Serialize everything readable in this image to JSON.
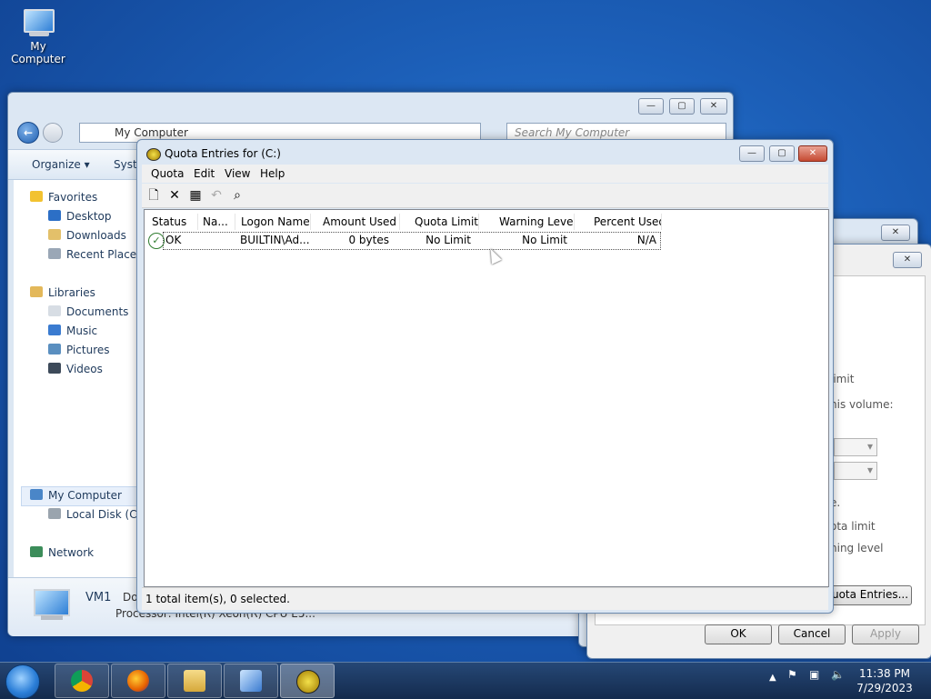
{
  "desktop": {
    "icon_label": "My Computer"
  },
  "explorer": {
    "address": "My Computer",
    "search_placeholder": "Search My Computer",
    "organize_label": "Organize",
    "system_label": "Syste",
    "nav": {
      "favorites": "Favorites",
      "desktop": "Desktop",
      "downloads": "Downloads",
      "recent_places": "Recent Places",
      "libraries": "Libraries",
      "documents": "Documents",
      "music": "Music",
      "pictures": "Pictures",
      "videos": "Videos",
      "my_computer": "My Computer",
      "local_disk": "Local Disk (C:)",
      "network": "Network"
    },
    "details": {
      "name": "VM1",
      "domain_partial": "Do",
      "processor_partial": "Processor: Intel(R) Xeon(R) CPU E5..."
    }
  },
  "quota": {
    "title": "Quota Entries for  (C:)",
    "menu": [
      "Quota",
      "Edit",
      "View",
      "Help"
    ],
    "columns": [
      "Status",
      "Na...",
      "Logon Name",
      "Amount Used",
      "Quota Limit",
      "Warning Level",
      "Percent Used"
    ],
    "rows": [
      {
        "status": "OK",
        "name": "",
        "logon": "BUILTIN\\Ad...",
        "amount": "0 bytes",
        "limit": "No Limit",
        "warning": "No Limit",
        "percent": "N/A"
      }
    ],
    "status_text": "1 total item(s), 0 selected."
  },
  "props_dialog": {
    "frag_limit": "limit",
    "frag_volume": "his volume:",
    "frag_e": "e.",
    "frag_quota_limit": "ota limit",
    "frag_warning": "ning level",
    "quota_entries_btn": "uota Entries...",
    "ok": "OK",
    "cancel": "Cancel",
    "apply": "Apply"
  },
  "taskbar": {
    "time": "11:38 PM",
    "date": "7/29/2023"
  },
  "colors": {
    "accent": "#1f5fb0",
    "taskbar": "#1c3a5e",
    "close": "#c54a32"
  }
}
